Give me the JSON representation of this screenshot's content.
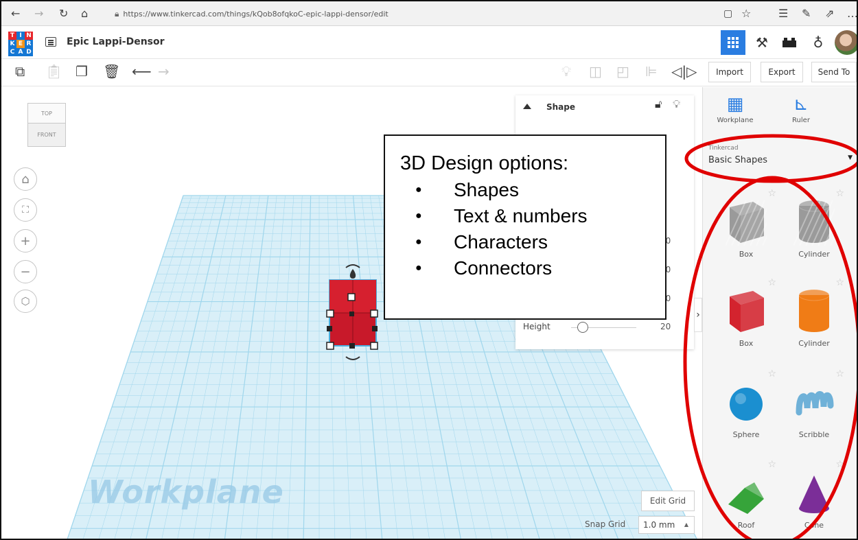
{
  "browser": {
    "url": "https://www.tinkercad.com/things/kQob8ofqkoC-epic-lappi-densor/edit",
    "back_icon": "arrow-left-icon",
    "forward_icon": "arrow-right-icon",
    "refresh_icon": "refresh-icon",
    "home_icon": "home-icon"
  },
  "app": {
    "logo_letters": [
      "T",
      "I",
      "N",
      "K",
      "E",
      "R",
      "C",
      "A",
      "D"
    ],
    "logo_colors": [
      "#e8262b",
      "#1477d4",
      "#e8262b",
      "#1477d4",
      "#f39418",
      "#1477d4",
      "#1477d4",
      "#1477d4",
      "#1477d4"
    ],
    "design_title": "Epic Lappi-Densor",
    "accent": "#2a7de1"
  },
  "toolbar": {
    "import_label": "Import",
    "export_label": "Export",
    "send_to_label": "Send To"
  },
  "viewcube": {
    "top_label": "TOP",
    "front_label": "FRONT"
  },
  "workplane": {
    "watermark": "Workplane",
    "edit_grid_label": "Edit Grid",
    "snap_grid_label": "Snap Grid",
    "snap_grid_value": "1.0 mm",
    "grid_color": "#9fd6ec"
  },
  "inspector": {
    "title": "Shape",
    "values": [
      "0",
      "10",
      "20",
      "20",
      "20"
    ],
    "height_label": "Height",
    "height_value": "20"
  },
  "callout": {
    "title": "3D Design options:",
    "items": [
      "Shapes",
      "Text & numbers",
      "Characters",
      "Connectors"
    ]
  },
  "right_panel": {
    "workplane_label": "Workplane",
    "ruler_label": "Ruler",
    "library_source": "Tinkercad",
    "library_name": "Basic Shapes",
    "shapes": [
      {
        "name": "Box",
        "color": "#9a9a9a"
      },
      {
        "name": "Cylinder",
        "color": "#9a9a9a"
      },
      {
        "name": "Box",
        "color": "#d3232e"
      },
      {
        "name": "Cylinder",
        "color": "#f07c16"
      },
      {
        "name": "Sphere",
        "color": "#1b8fd0"
      },
      {
        "name": "Scribble",
        "color": "#6fb1d8"
      },
      {
        "name": "Roof",
        "color": "#36a43a"
      },
      {
        "name": "Cone",
        "color": "#7b2e98"
      }
    ]
  },
  "highlight_color": "#e00000"
}
